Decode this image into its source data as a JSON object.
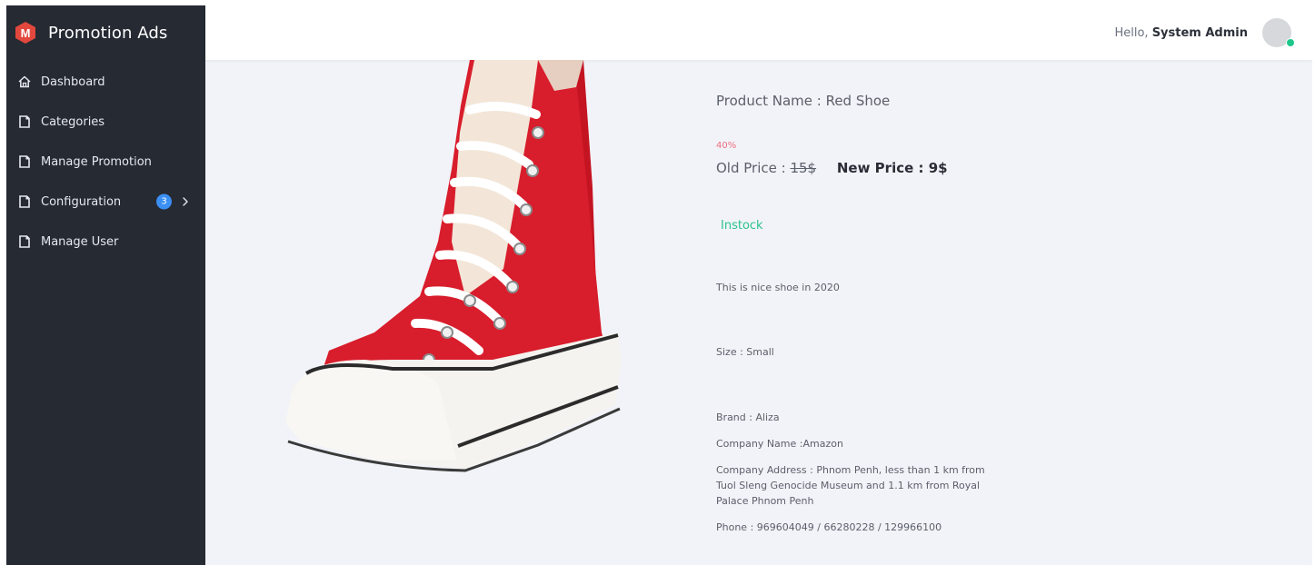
{
  "app": {
    "title": "Promotion Ads",
    "logo_letter": "M",
    "colors": {
      "logo": "#e2483d",
      "sidebar": "#262a33",
      "instock": "#2cc28d",
      "discount": "#ec6f81",
      "badge": "#3b8ff3",
      "online": "#1ec88a"
    }
  },
  "sidebar": {
    "items": [
      {
        "label": "Dashboard",
        "icon": "home-icon"
      },
      {
        "label": "Categories",
        "icon": "document-icon"
      },
      {
        "label": "Manage Promotion",
        "icon": "document-icon"
      },
      {
        "label": "Configuration",
        "icon": "document-icon",
        "badge": "3",
        "chevron": "chevron-right-icon"
      },
      {
        "label": "Manage User",
        "icon": "document-icon"
      }
    ]
  },
  "header": {
    "greeting": "Hello,",
    "user_name": "System Admin",
    "status": "online"
  },
  "product": {
    "image_alt": "red high-top canvas shoe",
    "name_label": "Product Name : Red Shoe",
    "discount": "40%",
    "old_price_label": "Old Price : ",
    "old_price_value": "15$",
    "new_price_label": "New Price : 9$",
    "stock": "Instock",
    "description": "This is nice shoe in 2020",
    "size": "Size : Small",
    "brand": "Brand : Aliza",
    "company_name": "Company Name :Amazon",
    "company_address": "Company Address : Phnom Penh, less than 1 km from Tuol Sleng Genocide Museum and 1.1 km from Royal Palace Phnom Penh",
    "phone": "Phone : 969604049 / 66280228 / 129966100"
  }
}
